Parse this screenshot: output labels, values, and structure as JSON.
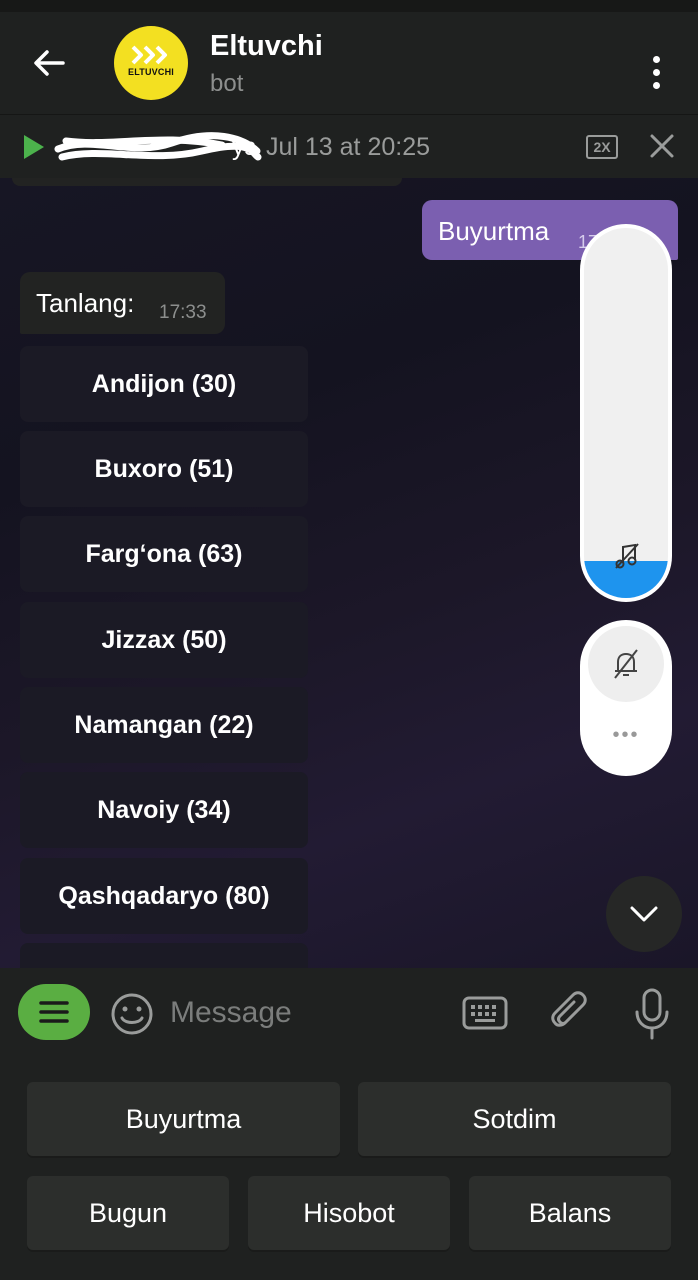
{
  "header": {
    "title": "Eltuvchi",
    "subtitle": "bot",
    "avatar_text": "ELTUVCHI"
  },
  "playback": {
    "performer": "уз",
    "time": "Jul 13 at 20:25",
    "speed": "2X"
  },
  "messages": {
    "outgoing": {
      "text": "Buyurtma",
      "time": "17:33"
    },
    "incoming": {
      "text": "Tanlang:",
      "time": "17:33"
    }
  },
  "inline_keyboard": [
    "Andijon (30)",
    "Buxoro (51)",
    "Farg‘ona (63)",
    "Jizzax (50)",
    "Namangan (22)",
    "Navoiy (34)",
    "Qashqadaryo (80)"
  ],
  "volume": {
    "level_fraction": 0.1,
    "fill_color": "#1e94ee"
  },
  "input": {
    "placeholder": "Message"
  },
  "reply_keyboard": {
    "row1": [
      "Buyurtma",
      "Sotdim"
    ],
    "row2": [
      "Bugun",
      "Hisobot",
      "Balans"
    ]
  },
  "colors": {
    "accent_green": "#5aae42",
    "outgoing_bubble": "#7b5fb0",
    "volume_blue": "#1e94ee"
  },
  "icons": [
    "back-arrow-icon",
    "more-vertical-icon",
    "play-icon",
    "close-icon",
    "music-off-icon",
    "bell-off-icon",
    "chevron-down-icon",
    "menu-icon",
    "emoji-icon",
    "keyboard-icon",
    "paperclip-icon",
    "microphone-icon"
  ]
}
